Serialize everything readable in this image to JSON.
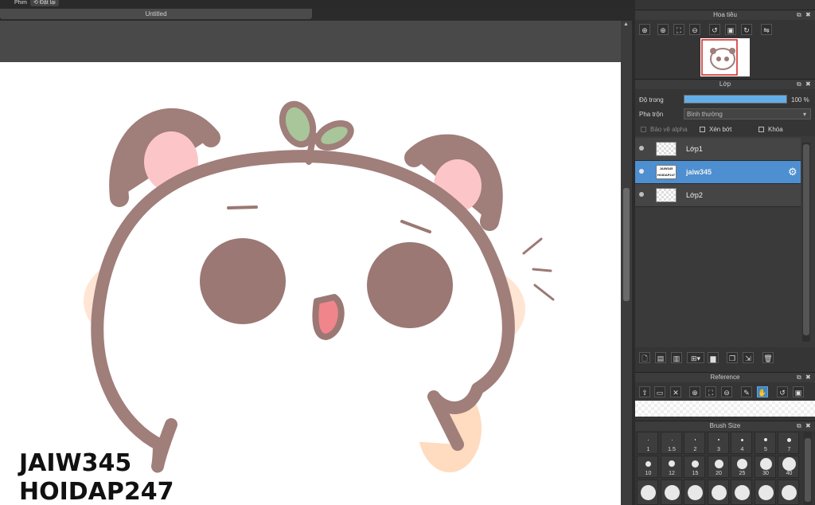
{
  "topbar": {
    "menu_partial": "Phim",
    "undo_label": "Đặt lại"
  },
  "document": {
    "tab_title": "Untitled"
  },
  "canvas": {
    "watermark_line1": "JAIW345",
    "watermark_line2": "HOIDAP247",
    "colors": {
      "outline": "#a07e7a",
      "blush": "#ffcfae",
      "ear_inner": "#fcc6c8",
      "leaf": "#a9c59a"
    }
  },
  "navigator": {
    "title": "Hoa tiêu",
    "tools": [
      "zoom-in",
      "zoom-in",
      "fit",
      "zoom-out",
      "rotate-left",
      "reset",
      "rotate-right",
      "flip"
    ]
  },
  "layers": {
    "title": "Lớp",
    "opacity_label": "Độ trong",
    "opacity_value": "100 %",
    "opacity_fraction": 1.0,
    "blend_label": "Pha trộn",
    "blend_value": "Bình thường",
    "protect_alpha_label": "Bảo vệ alpha",
    "clipping_label": "Xén bớt",
    "lock_label": "Khóa",
    "items": [
      {
        "name": "Lớp1",
        "selected": false
      },
      {
        "name": "jaiw345",
        "selected": true
      },
      {
        "name": "Lớp2",
        "selected": false
      }
    ],
    "thumb_text": "JAIW345 HOIDAP247"
  },
  "reference": {
    "title": "Reference"
  },
  "brush_size": {
    "title": "Brush Size",
    "row1": [
      "1",
      "1.5",
      "2",
      "3",
      "4",
      "5",
      "7"
    ],
    "row2": [
      "10",
      "12",
      "15",
      "20",
      "25",
      "30",
      "40"
    ]
  },
  "accent_color": "#4d8fd0"
}
